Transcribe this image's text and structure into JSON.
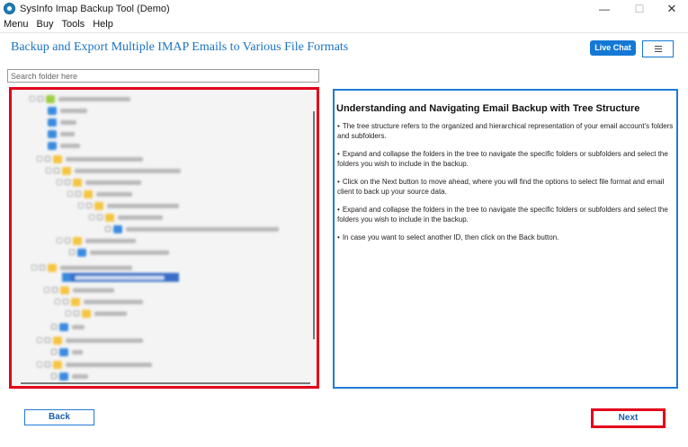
{
  "window": {
    "title": "SysInfo Imap Backup Tool (Demo)",
    "minimize_glyph": "—",
    "maximize_glyph": "☐",
    "close_glyph": "✕"
  },
  "menu": {
    "items": [
      "Menu",
      "Buy",
      "Tools",
      "Help"
    ]
  },
  "header": {
    "title": "Backup and Export Multiple IMAP Emails to Various File Formats",
    "live_chat_label": "Live Chat",
    "hamburger_icon": "menu-icon"
  },
  "search": {
    "placeholder": "Search folder here",
    "value": ""
  },
  "tree": {
    "note": "",
    "colors": {
      "folder": "#f5c542",
      "mail": "#3a8be0",
      "account": "#9ccf46",
      "selection": "#3a6ec6",
      "highlight_border": "#e3001b"
    }
  },
  "info": {
    "heading": "Understanding and Navigating Email Backup with Tree Structure",
    "items": [
      "The tree structure refers to the organized and hierarchical representation of your email account's folders and subfolders.",
      "Expand and collapse the folders in the tree to navigate the specific folders or subfolders and select the folders you wish to include in the backup.",
      "Click on the Next button to move ahead, where you will find the options to select file format and email client to back up your source data.",
      "Expand and collapse the folders in the tree to navigate the specific folders or subfolders and select the folders you wish to include in the backup.",
      "In case you want to select another ID, then click on the Back button."
    ],
    "bullet": "•"
  },
  "footer": {
    "back_label": "Back",
    "next_label": "Next"
  },
  "colors": {
    "accent": "#1478d4",
    "title_blue": "#1a73c2",
    "highlight_red": "#e3001b"
  }
}
